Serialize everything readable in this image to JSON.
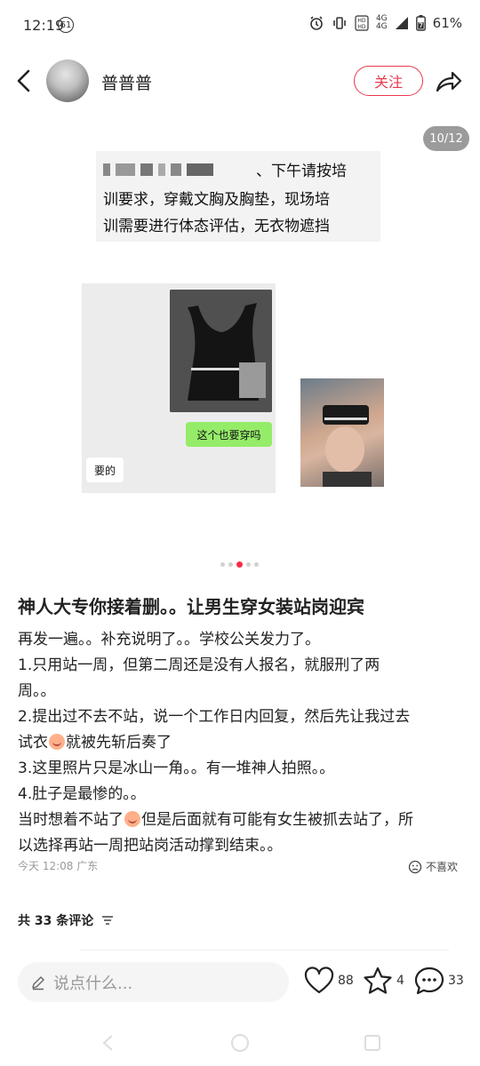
{
  "status_bar": {
    "time": "12:19",
    "notif_count": "61",
    "network_top": "4G",
    "network_bottom": "4G",
    "battery": "61%"
  },
  "header": {
    "author": "普普普",
    "follow_label": "关注"
  },
  "media": {
    "counter": "10/12",
    "chat_top_lines": [
      "、下午请按培",
      "训要求，穿戴文胸及胸垫，现场培",
      "训需要进行体态评估，无衣物遮挡"
    ],
    "bubble_green": "这个也要穿吗",
    "bubble_white": "要的",
    "dots_active_index": 2
  },
  "post": {
    "title": "神人大专你接着删。。让男生穿女装站岗迎宾",
    "lines": [
      "再发一遍。。补充说明了。。学校公关发力了。",
      "1.只用站一周，但第二周还是没有人报名，就服刑了两",
      "周。。",
      "2.提出过不去不站，说一个工作日内回复，然后先让我过去",
      "试衣",
      "就被先斩后奏了",
      "3.这里照片只是冰山一角。。有一堆神人拍照。。",
      "4.肚子是最惨的。。",
      "当时想着不站了",
      "但是后面就有可能有女生被抓去站了，所",
      "以选择再站一周把站岗活动撑到结束。。"
    ],
    "time": "今天 12:08",
    "location": "广东",
    "dislike_label": "不喜欢",
    "comments_prefix": "共",
    "comments_count": "33",
    "comments_suffix": "条评论"
  },
  "bottom_bar": {
    "placeholder": "说点什么...",
    "likes": "88",
    "stars": "4",
    "comments": "33"
  },
  "colors": {
    "accent": "#e8394d",
    "active_dot": "#ff2a4a",
    "wechat_green": "#95ec69"
  }
}
